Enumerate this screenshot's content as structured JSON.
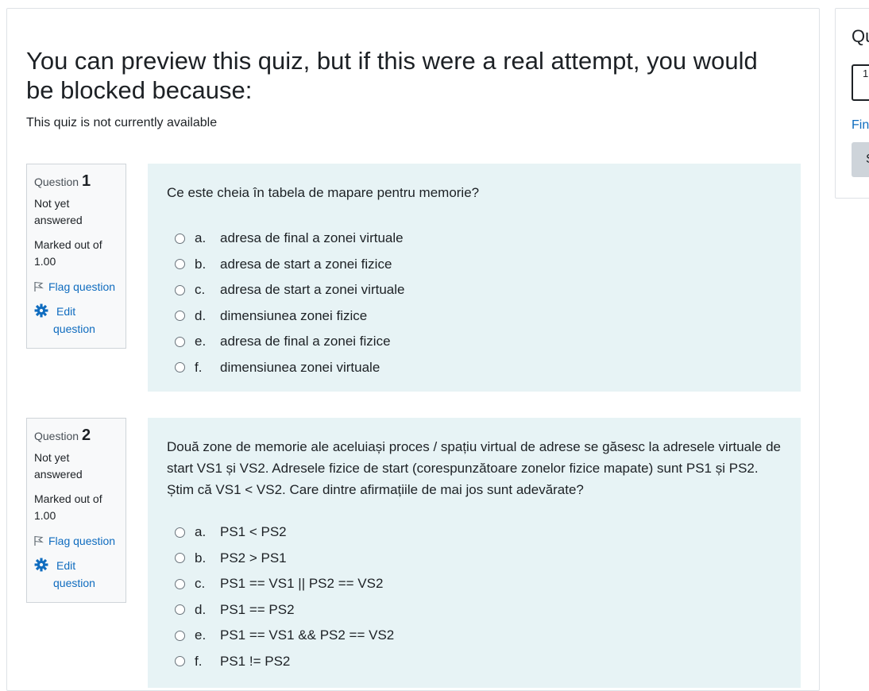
{
  "blocked": {
    "heading": "You can preview this quiz, but if this were a real attempt, you would be blocked because:",
    "reason": "This quiz is not currently available"
  },
  "questions": [
    {
      "label": "Question",
      "number": "1",
      "state": "Not yet answered",
      "grade": "Marked out of 1.00",
      "flag_label": "Flag question",
      "edit_label": "Edit question",
      "text": "Ce este cheia în tabela de mapare pentru memorie?",
      "answers": [
        {
          "letter": "a.",
          "text": "adresa de final a zonei virtuale"
        },
        {
          "letter": "b.",
          "text": "adresa de start a zonei fizice"
        },
        {
          "letter": "c.",
          "text": "adresa de start a zonei virtuale"
        },
        {
          "letter": "d.",
          "text": "dimensiunea zonei fizice"
        },
        {
          "letter": "e.",
          "text": "adresa de final a zonei fizice"
        },
        {
          "letter": "f.",
          "text": "dimensiunea zonei virtuale"
        }
      ]
    },
    {
      "label": "Question",
      "number": "2",
      "state": "Not yet answered",
      "grade": "Marked out of 1.00",
      "flag_label": "Flag question",
      "edit_label": "Edit question",
      "text": "Două zone de memorie ale aceluiași proces / spațiu virtual de adrese se găsesc la adresele virtuale de start VS1 și VS2. Adresele fizice de start (corespunzătoare zonelor fizice mapate) sunt PS1 și PS2. Știm că VS1 < VS2. Care dintre afirmațiile de mai jos sunt adevărate?",
      "answers": [
        {
          "letter": "a.",
          "text": "PS1 < PS2"
        },
        {
          "letter": "b.",
          "text": "PS2 > PS1"
        },
        {
          "letter": "c.",
          "text": "PS1 == VS1 || PS2 == VS2"
        },
        {
          "letter": "d.",
          "text": "PS1 == PS2"
        },
        {
          "letter": "e.",
          "text": "PS1 == VS1 && PS2 == VS2"
        },
        {
          "letter": "f.",
          "text": "PS1 != PS2"
        }
      ]
    }
  ],
  "sidebar": {
    "title": "Qu",
    "nav_button": "1",
    "finish_link": "Fin",
    "start_button": "S"
  },
  "colors": {
    "link": "#0f6cbf",
    "content_bg": "#e7f3f5",
    "info_bg": "#f8f9fa"
  },
  "icons": {
    "flag": "flag-icon",
    "edit": "gear-icon"
  }
}
